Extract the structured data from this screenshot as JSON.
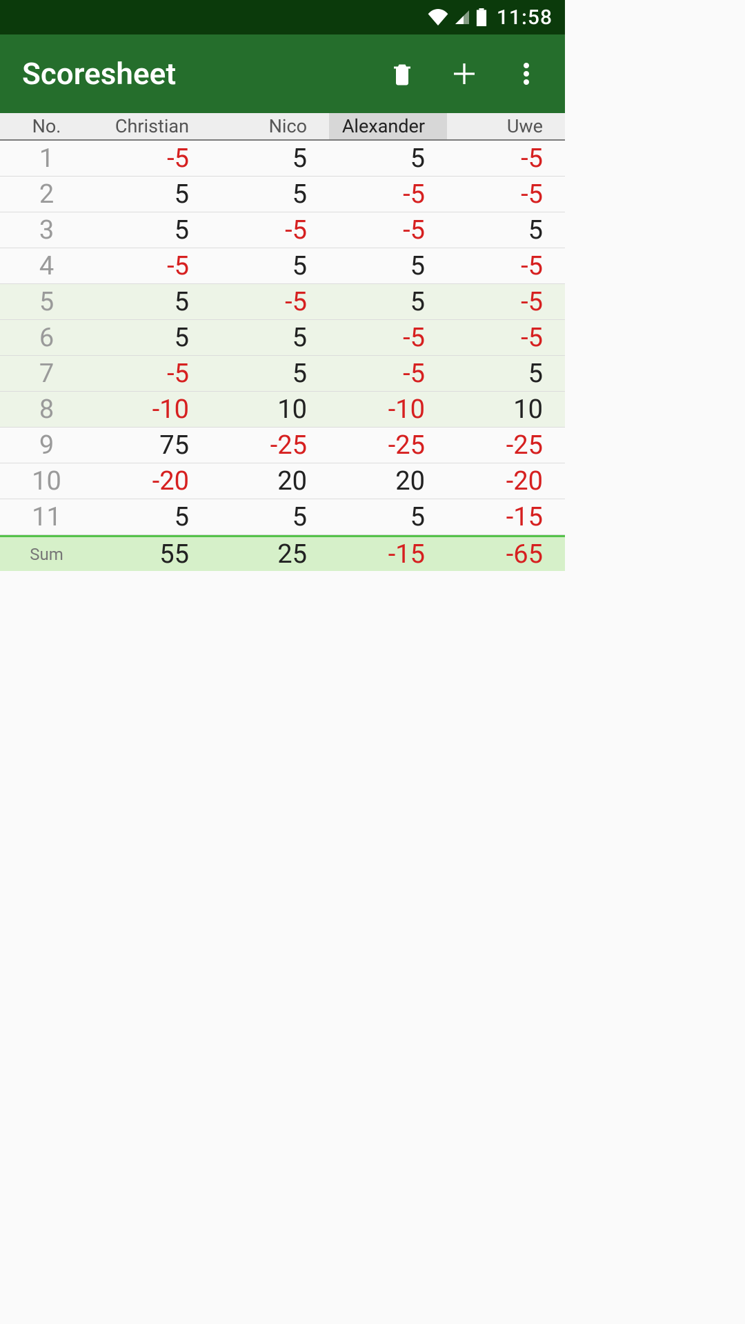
{
  "statusbar": {
    "time": "11:58"
  },
  "appbar": {
    "title": "Scoresheet"
  },
  "table": {
    "header": {
      "no_label": "No.",
      "players": [
        "Christian",
        "Nico",
        "Alexander",
        "Uwe"
      ],
      "selected_index": 2
    },
    "rows": [
      {
        "no": "1",
        "vals": [
          -5,
          5,
          5,
          -5
        ],
        "highlight": false
      },
      {
        "no": "2",
        "vals": [
          5,
          5,
          -5,
          -5
        ],
        "highlight": false
      },
      {
        "no": "3",
        "vals": [
          5,
          -5,
          -5,
          5
        ],
        "highlight": false
      },
      {
        "no": "4",
        "vals": [
          -5,
          5,
          5,
          -5
        ],
        "highlight": false
      },
      {
        "no": "5",
        "vals": [
          5,
          -5,
          5,
          -5
        ],
        "highlight": true
      },
      {
        "no": "6",
        "vals": [
          5,
          5,
          -5,
          -5
        ],
        "highlight": true
      },
      {
        "no": "7",
        "vals": [
          -5,
          5,
          -5,
          5
        ],
        "highlight": true
      },
      {
        "no": "8",
        "vals": [
          -10,
          10,
          -10,
          10
        ],
        "highlight": true
      },
      {
        "no": "9",
        "vals": [
          75,
          -25,
          -25,
          -25
        ],
        "highlight": false
      },
      {
        "no": "10",
        "vals": [
          -20,
          20,
          20,
          -20
        ],
        "highlight": false
      },
      {
        "no": "11",
        "vals": [
          5,
          5,
          5,
          -15
        ],
        "highlight": false
      }
    ],
    "sum": {
      "label": "Sum",
      "vals": [
        55,
        25,
        -15,
        -65
      ]
    }
  }
}
